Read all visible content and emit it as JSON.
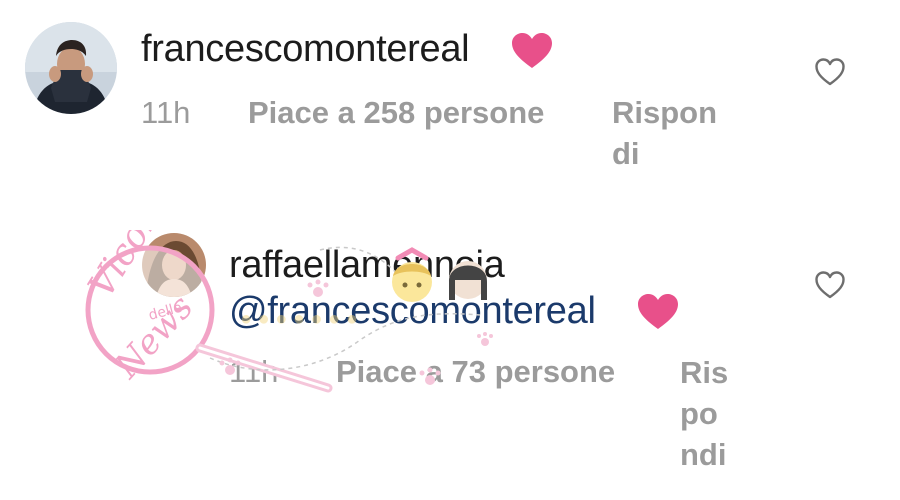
{
  "comments": [
    {
      "username": "francescomontereal",
      "time": "11h",
      "likes": "Piace a 258 persone",
      "reply_lines": [
        "Rispon",
        "di"
      ]
    },
    {
      "username": "raffaellamennoia",
      "mention": "@francescomontereal",
      "time": "11h",
      "likes": "Piace a 73 persone",
      "reply_lines": [
        "Ris",
        "po",
        "ndi"
      ]
    }
  ],
  "watermark": {
    "script_top": "Vicolo",
    "script_small": "delle",
    "script_bottom": "News"
  },
  "colors": {
    "heart_emoji": "#e8508a",
    "meta_gray": "#9b9b9b",
    "mention_blue": "#1b3a6b",
    "watermark_pink": "#f2a3c6"
  },
  "icons": {
    "inline_heart": "pink-heart-emoji",
    "like_button": "heart-outline-icon"
  }
}
